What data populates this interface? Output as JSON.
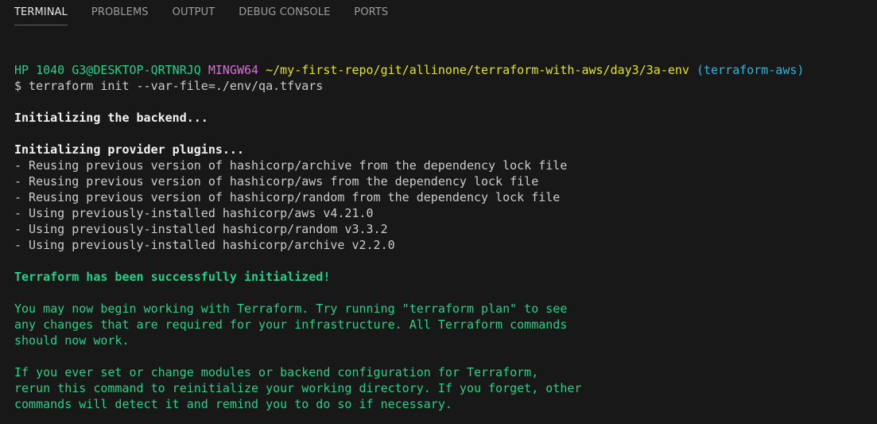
{
  "panel": {
    "tabs": [
      {
        "label": "TERMINAL",
        "active": true
      },
      {
        "label": "PROBLEMS",
        "active": false
      },
      {
        "label": "OUTPUT",
        "active": false
      },
      {
        "label": "DEBUG CONSOLE",
        "active": false
      },
      {
        "label": "PORTS",
        "active": false
      }
    ],
    "accent_color": "#0078d4"
  },
  "terminal": {
    "prompt": {
      "host": "HP 1040 G3@DESKTOP-QRTNRJQ",
      "shell": "MINGW64",
      "path": "~/my-first-repo/git/allinone/terraform-with-aws/day3/3a-env",
      "branch": "(terraform-aws)"
    },
    "command": "$ terraform init --var-file=./env/qa.tfvars",
    "backend_heading": "Initializing the backend...",
    "plugins_heading": "Initializing provider plugins...",
    "plugin_lines": [
      "- Reusing previous version of hashicorp/archive from the dependency lock file",
      "- Reusing previous version of hashicorp/aws from the dependency lock file",
      "- Reusing previous version of hashicorp/random from the dependency lock file",
      "- Using previously-installed hashicorp/aws v4.21.0",
      "- Using previously-installed hashicorp/random v3.3.2",
      "- Using previously-installed hashicorp/archive v2.2.0"
    ],
    "success_heading": "Terraform has been successfully initialized!",
    "info_paragraph_1": [
      "You may now begin working with Terraform. Try running \"terraform plan\" to see",
      "any changes that are required for your infrastructure. All Terraform commands",
      "should now work."
    ],
    "info_paragraph_2": [
      "If you ever set or change modules or backend configuration for Terraform,",
      "rerun this command to reinitialize your working directory. If you forget, other",
      "commands will detect it and remind you to do so if necessary."
    ],
    "colors": {
      "background": "#181818",
      "default_text": "#cccccc",
      "green": "#23d18b",
      "magenta": "#d670d6",
      "yellow": "#e5e510",
      "cyan": "#29b8db"
    }
  }
}
